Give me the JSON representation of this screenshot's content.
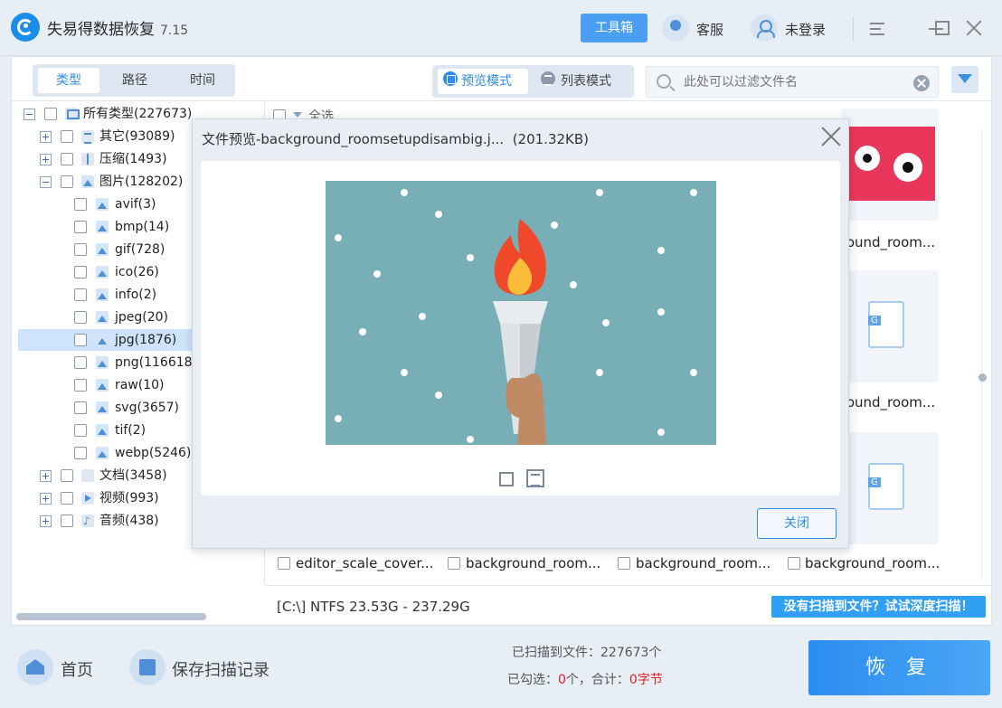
{
  "app": {
    "name": "失易得数据恢复",
    "version": "7.15"
  },
  "titlebar": {
    "toolbox_label": "工具箱",
    "service_label": "客服",
    "login_label": "未登录",
    "icons": [
      "menu-icon",
      "minimize-icon",
      "maximize-icon",
      "close-icon"
    ]
  },
  "sidebar": {
    "tabs": [
      {
        "label": "类型",
        "active": true
      },
      {
        "label": "路径"
      },
      {
        "label": "时间"
      }
    ],
    "tree": [
      {
        "label": "所有类型(227673)",
        "icon": "monitor-icon"
      },
      {
        "label": "其它(93089)",
        "icon": "other-icon"
      },
      {
        "label": "压缩(1493)",
        "icon": "zip-icon"
      },
      {
        "label": "图片(128202)",
        "icon": "image-icon"
      },
      {
        "label": "avif(3)"
      },
      {
        "label": "bmp(14)"
      },
      {
        "label": "gif(728)"
      },
      {
        "label": "ico(26)"
      },
      {
        "label": "info(2)"
      },
      {
        "label": "jpeg(20)"
      },
      {
        "label": "jpg(1876)",
        "selected": true
      },
      {
        "label": "png(116618"
      },
      {
        "label": "raw(10)"
      },
      {
        "label": "svg(3657)"
      },
      {
        "label": "tif(2)"
      },
      {
        "label": "webp(5246)"
      },
      {
        "label": "文档(3458)",
        "icon": "document-icon"
      },
      {
        "label": "视频(993)",
        "icon": "video-icon"
      },
      {
        "label": "音频(438)",
        "icon": "audio-icon"
      }
    ]
  },
  "toolbar": {
    "preview_mode_label": "预览模式",
    "list_mode_label": "列表模式",
    "filter_placeholder": "此处可以过滤文件名",
    "select_all_label": "全选"
  },
  "files": {
    "thumb_names": [
      "round_room...",
      "round_room...",
      "round_room..."
    ],
    "thumb_badge": "G",
    "bottom_row": [
      "editor_scale_cover...",
      "background_room...",
      "background_room...",
      "background_room..."
    ]
  },
  "status": {
    "disk_info": "[C:\\] NTFS 23.53G - 237.29G",
    "deep_scan_label": "没有扫描到文件？试试深度扫描！"
  },
  "footer": {
    "home_label": "首页",
    "save_scan_label": "保存扫描记录",
    "scanned_prefix": "已扫描到文件：",
    "scanned_count": "227673",
    "scanned_unit": "个",
    "selected_prefix": "已勾选：",
    "selected_count": "0",
    "selected_mid": "个，合计：",
    "selected_size": "0字节",
    "recover_label": "恢 复"
  },
  "modal": {
    "title": "文件预览-background_roomsetupdisambig.j...",
    "size": "(201.32KB)",
    "close_label": "关闭",
    "icons": [
      "fit-to-window-icon",
      "actual-size-icon"
    ],
    "image_colors": {
      "background": "#78aeb6",
      "flame_outer": "#f0482a",
      "flame_inner": "#fbbd3a",
      "torch": "#e9ecee",
      "hand": "#c08a64"
    }
  },
  "colors": {
    "accent": "#2d8cf0",
    "danger": "#e02020"
  }
}
